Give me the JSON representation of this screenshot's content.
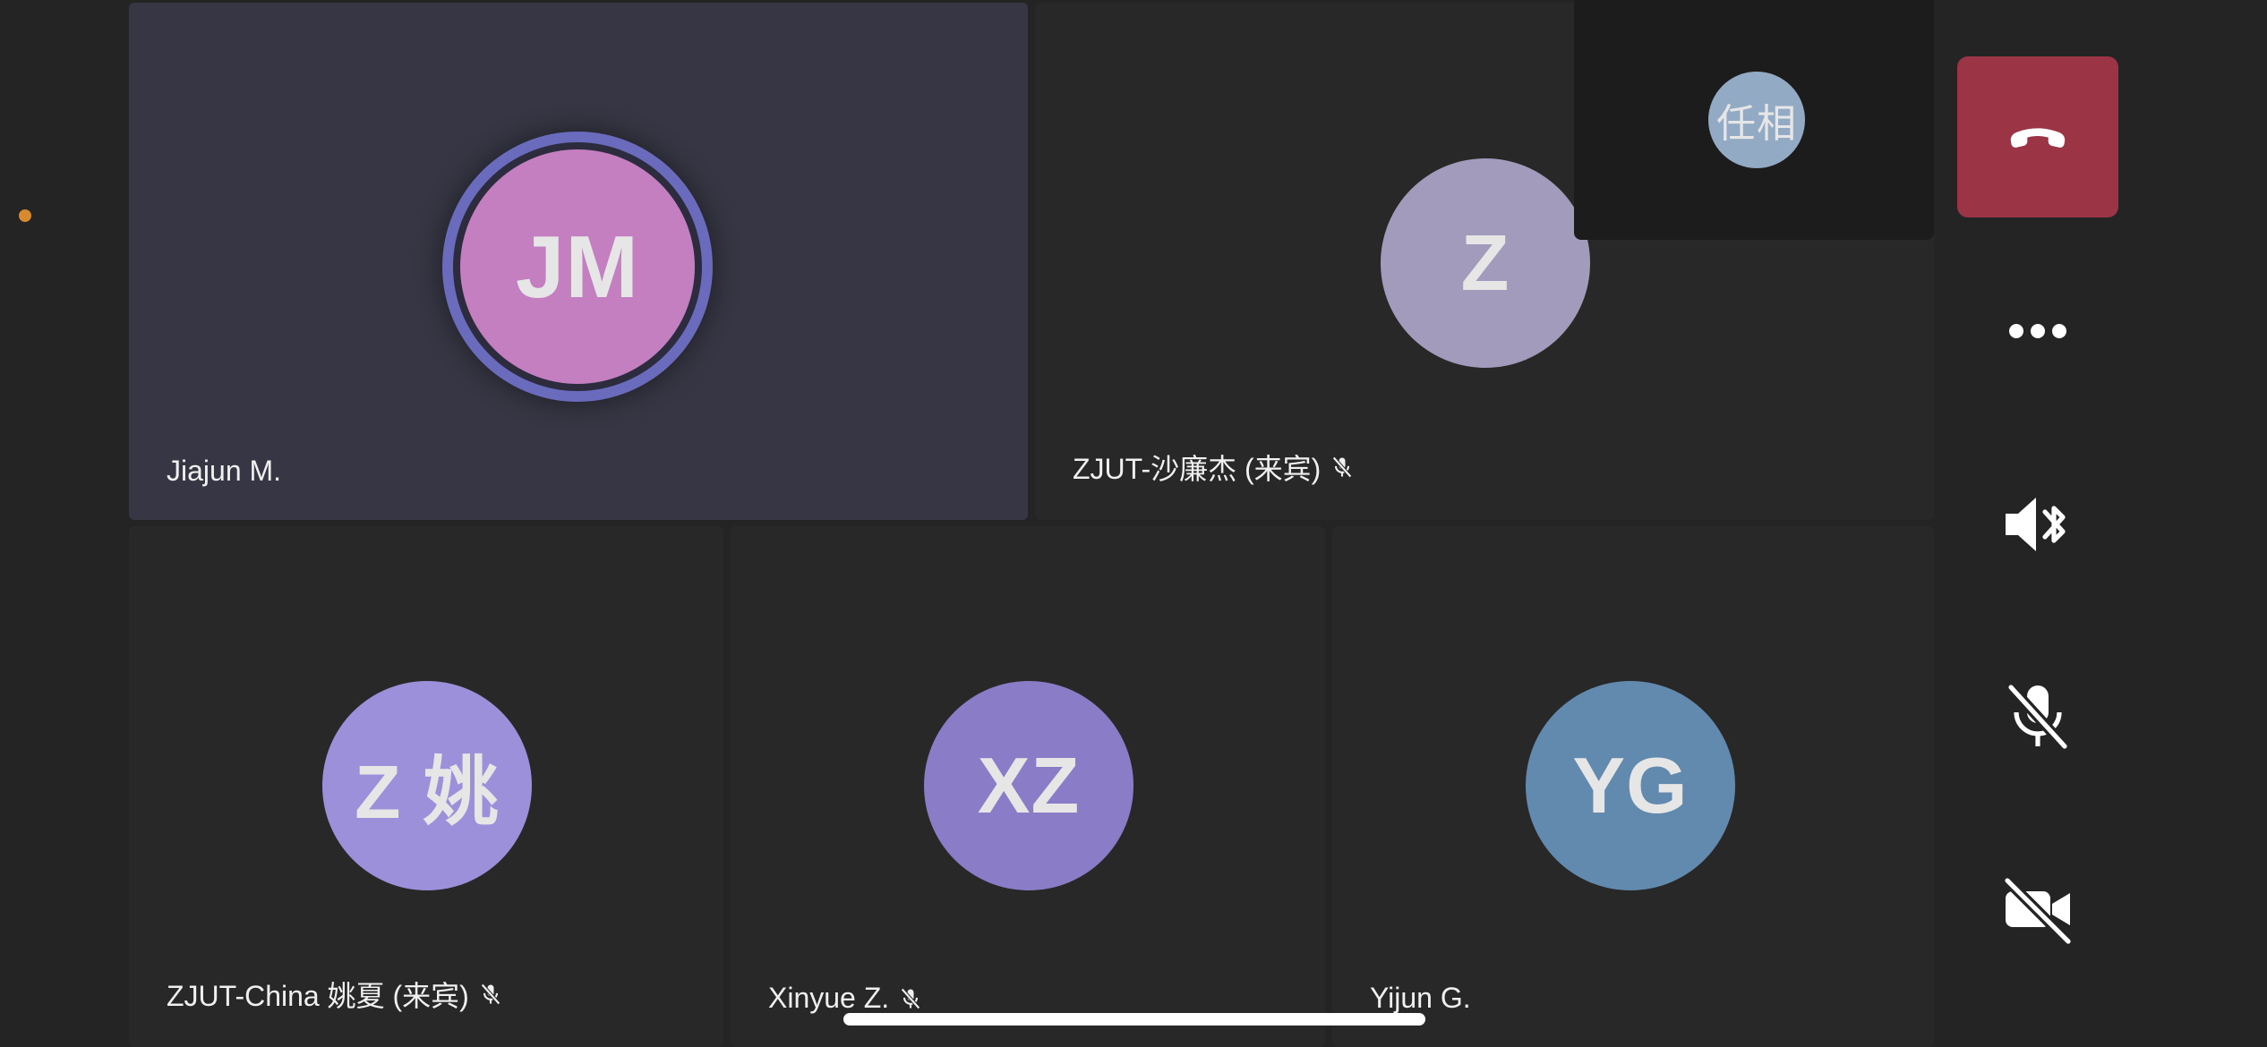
{
  "colors": {
    "background": "#242424",
    "tile": "#282828",
    "active_tile": "#363644",
    "end_call": "#9b3546",
    "speaking_ring": "#6a6bbd"
  },
  "participants": [
    {
      "initials": "JM",
      "name": "Jiajun M.",
      "avatar_color": "#c37fc0",
      "muted": false,
      "speaking": true
    },
    {
      "initials": "Z",
      "name": "ZJUT-沙廉杰 (来宾)",
      "avatar_color": "#a39bbb",
      "muted": true,
      "speaking": false
    },
    {
      "initials": "Z 姚",
      "name": "ZJUT-China 姚夏 (来宾)",
      "avatar_color": "#9d90db",
      "muted": true,
      "speaking": false
    },
    {
      "initials": "XZ",
      "name": "Xinyue Z.",
      "avatar_color": "#8a7cc6",
      "muted": true,
      "speaking": false
    },
    {
      "initials": "YG",
      "name": "Yijun G.",
      "avatar_color": "#6289ae",
      "muted": false,
      "speaking": false
    }
  ],
  "self_view": {
    "initials": "任相",
    "avatar_color": "#92aac4"
  },
  "controls": [
    {
      "id": "end-call",
      "icon": "phone-hangup-icon"
    },
    {
      "id": "more",
      "icon": "more-dots-icon"
    },
    {
      "id": "audio-output",
      "icon": "speaker-bluetooth-icon"
    },
    {
      "id": "mic",
      "icon": "mic-off-icon"
    },
    {
      "id": "camera",
      "icon": "camera-off-icon"
    }
  ]
}
